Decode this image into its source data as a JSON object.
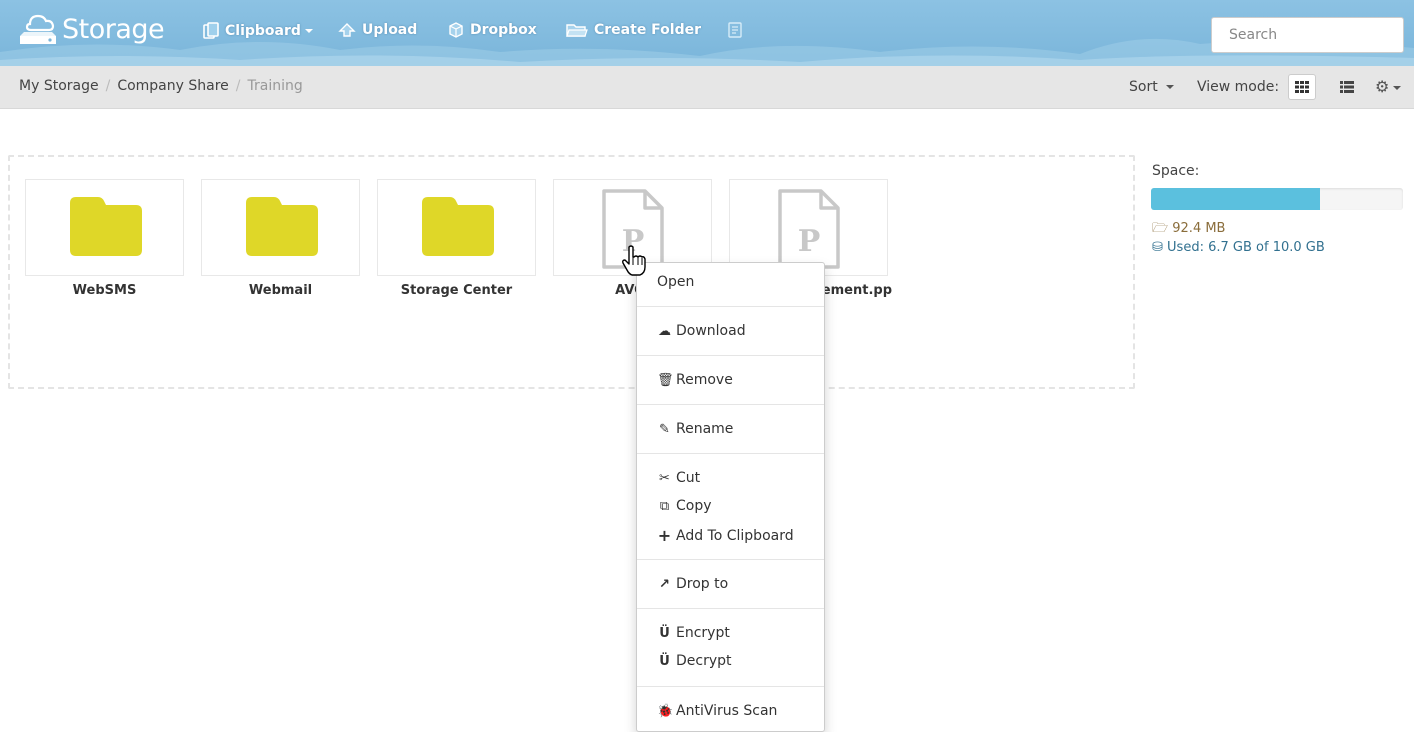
{
  "header": {
    "brand": "Storage",
    "toolbar": {
      "clipboard": "Clipboard",
      "upload": "Upload",
      "dropbox": "Dropbox",
      "create_folder": "Create Folder"
    },
    "search_placeholder": "Search"
  },
  "breadcrumb": {
    "items": [
      "My Storage",
      "Company Share",
      "Training"
    ],
    "sort_label": "Sort",
    "view_mode_label": "View mode:"
  },
  "files": [
    {
      "name": "WebSMS",
      "type": "folder"
    },
    {
      "name": "Webmail",
      "type": "folder"
    },
    {
      "name": "Storage Center",
      "type": "folder"
    },
    {
      "name": "AVO.",
      "type": "ppt"
    },
    {
      "name": "ement.pp",
      "type": "ppt"
    }
  ],
  "space": {
    "label": "Space:",
    "used_fraction": 0.67,
    "folder_size": "92.4 MB",
    "used_text": "Used: 6.7 GB of 10.0 GB"
  },
  "context_menu": {
    "open": "Open",
    "download": "Download",
    "remove": "Remove",
    "rename": "Rename",
    "cut": "Cut",
    "copy": "Copy",
    "add_to_clipboard": "Add To Clipboard",
    "drop_to": "Drop to",
    "encrypt": "Encrypt",
    "decrypt": "Decrypt",
    "antivirus": "AntiVirus Scan"
  },
  "colors": {
    "header_blue": "#7ab5da",
    "folder_yellow": "#dfd728",
    "progress_blue": "#5bc0de"
  }
}
